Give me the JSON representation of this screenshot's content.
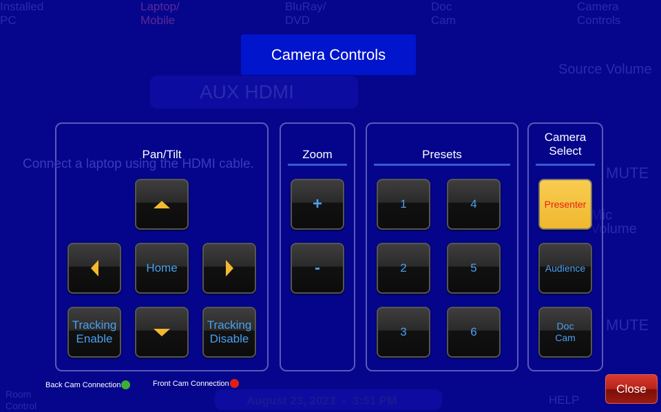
{
  "background": {
    "sources": [
      "Installed PC",
      "Laptop/ Mobile",
      "BluRay/ DVD",
      "Doc Cam",
      "Camera Controls"
    ],
    "aux_label": "AUX HDMI",
    "hint": "Connect a laptop using the HDMI cable.",
    "source_volume": "Source Volume",
    "mic_volume": "Mic Volume",
    "mute1": "MUTE",
    "mute2": "MUTE",
    "date": "August 23, 2023  -  3:51 PM",
    "help": "HELP",
    "room_control": "Room Control"
  },
  "dialog": {
    "title": "Camera Controls",
    "pan_tilt": {
      "title": "Pan/Tilt",
      "home": "Home",
      "tracking_enable": "Tracking Enable",
      "tracking_disable": "Tracking Disable"
    },
    "zoom": {
      "title": "Zoom",
      "in": "+",
      "out": "-"
    },
    "presets": {
      "title": "Presets",
      "items": [
        "1",
        "2",
        "3",
        "4",
        "5",
        "6"
      ]
    },
    "camera_select": {
      "title": "Camera Select",
      "items": [
        "Presenter",
        "Audience",
        "Doc Cam"
      ],
      "selected": "Presenter"
    },
    "status": {
      "back": "Back Cam Connection",
      "back_color": "#3cb030",
      "front": "Front Cam Connection",
      "front_color": "#e02010"
    },
    "close": "Close"
  },
  "colors": {
    "background": "#06068c",
    "title_bar": "#0015cc",
    "selected": "#f4c040",
    "button_text": "#4aa0f0"
  }
}
